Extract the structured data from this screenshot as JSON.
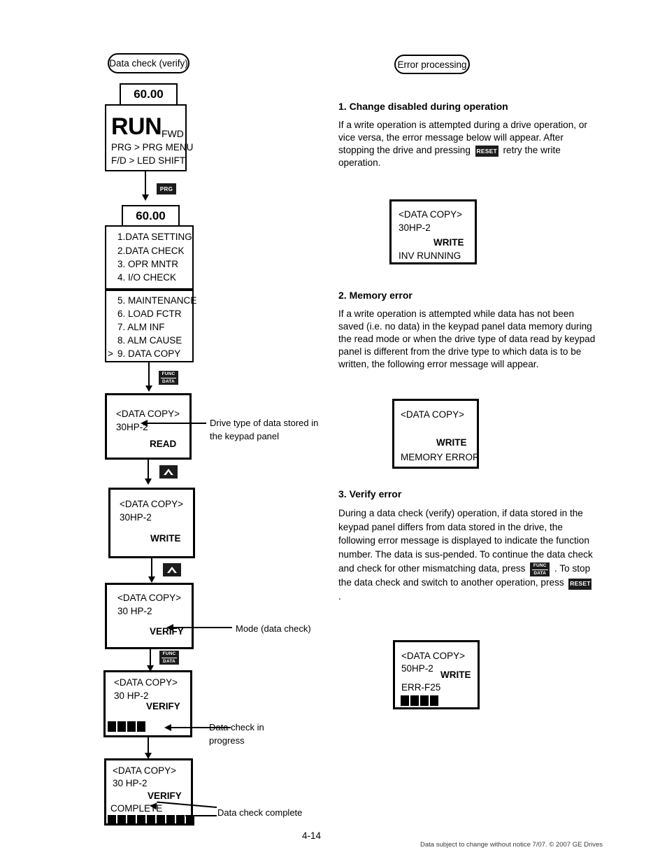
{
  "page": {
    "number": "4-14",
    "legal": "Data subject to change without notice 7/07. © 2007 GE Drives"
  },
  "left_column": {
    "title": "Data check (verify)",
    "step1": {
      "freq": "60.00",
      "run": "RUN",
      "dir": "FWD",
      "line1": "PRG > PRG MENU",
      "line2": "F/D > LED SHIFT"
    },
    "key_prg": "PRG",
    "step2": {
      "freq": "60.00",
      "menu_top": [
        "1.DATA SETTING",
        "2.DATA CHECK",
        "3. OPR MNTR",
        "4. I/O CHECK"
      ],
      "menu_bottom": [
        "5. MAINTENANCE",
        "6. LOAD FCTR",
        "7. ALM INF",
        "8. ALM CAUSE"
      ],
      "menu_selected_cursor": ">",
      "menu_selected": "9. DATA COPY"
    },
    "key_funcdata": {
      "top": "FUNC",
      "bottom": "DATA"
    },
    "step3": {
      "title": "<DATA COPY>",
      "model": "30HP-2",
      "mode": "READ"
    },
    "callout_drive_type": "Drive type of data stored in\nthe keypad panel",
    "key_up": "up-arrow",
    "step4": {
      "title": "<DATA COPY>",
      "model": "30HP-2",
      "mode": "WRITE"
    },
    "step5": {
      "title": "<DATA COPY>",
      "model": "30 HP-2",
      "mode": "VERIFY"
    },
    "callout_mode": "Mode (data check)",
    "step6": {
      "title": "<DATA COPY>",
      "model": "30 HP-2",
      "mode": "VERIFY",
      "progress_blocks": 4
    },
    "callout_in_progress": "Data check in\nprogress",
    "step7": {
      "title": "<DATA COPY>",
      "model": "30 HP-2",
      "mode": "VERIFY",
      "status": "COMPLETE",
      "progress_blocks": 9
    },
    "callout_complete": "Data check complete"
  },
  "right_column": {
    "title": "Error processing",
    "sections": [
      {
        "heading": "1. Change disabled during operation",
        "body_before_key": "If a write operation is attempted during a drive operation, or vice versa, the error message below will appear. After stopping the drive and pressing",
        "key": "RESET",
        "body_after_key": "retry the write operation."
      },
      {
        "heading": "2. Memory error",
        "body": "If a write operation is attempted while data has not been saved (i.e. no data) in the keypad panel data memory during the read mode or when the drive type of data read by keypad panel is different from the drive type to which data is to be written, the following error message will appear."
      },
      {
        "heading": "3. Verify error",
        "body_part1": "During a data check (verify) operation, if data stored in the keypad panel differs from data stored in the drive, the following error message is displayed to indicate the function number. The data is sus-pended. To continue the data check and check for other mismatching data, press",
        "key1_top": "FUNC",
        "key1_bottom": "DATA",
        "body_part2": ". To stop the data check and switch to another operation, press",
        "key2": "RESET",
        "body_part3": "."
      }
    ],
    "display1": {
      "title": "<DATA COPY>",
      "model": "30HP-2",
      "mode": "WRITE",
      "status": "INV RUNNING"
    },
    "display2": {
      "title": "<DATA COPY>",
      "model": "",
      "mode": "WRITE",
      "status": "MEMORY ERROR"
    },
    "display3": {
      "title": "<DATA COPY>",
      "model": "50HP-2",
      "mode": "WRITE",
      "status": "ERR-F25",
      "progress_blocks": 4
    }
  }
}
